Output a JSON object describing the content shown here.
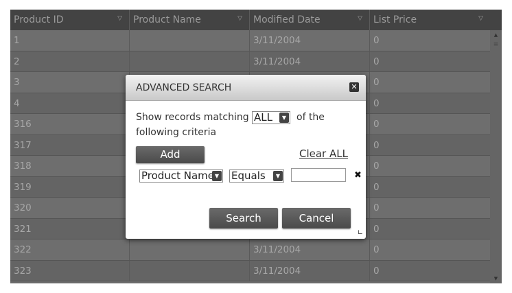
{
  "grid": {
    "columns": [
      {
        "label": "Product ID"
      },
      {
        "label": "Product Name"
      },
      {
        "label": "Modified Date"
      },
      {
        "label": "List Price"
      }
    ],
    "rows": [
      {
        "id": "1",
        "name": "",
        "date": "3/11/2004",
        "price": "0"
      },
      {
        "id": "2",
        "name": "",
        "date": "3/11/2004",
        "price": "0"
      },
      {
        "id": "3",
        "name": "",
        "date": "",
        "price": "0"
      },
      {
        "id": "4",
        "name": "",
        "date": "",
        "price": "0"
      },
      {
        "id": "316",
        "name": "",
        "date": "",
        "price": "0"
      },
      {
        "id": "317",
        "name": "",
        "date": "",
        "price": "0"
      },
      {
        "id": "318",
        "name": "",
        "date": "",
        "price": "0"
      },
      {
        "id": "319",
        "name": "",
        "date": "",
        "price": "0"
      },
      {
        "id": "320",
        "name": "",
        "date": "",
        "price": "0"
      },
      {
        "id": "321",
        "name": "",
        "date": "",
        "price": "0"
      },
      {
        "id": "322",
        "name": "",
        "date": "3/11/2004",
        "price": "0"
      },
      {
        "id": "323",
        "name": "",
        "date": "3/11/2004",
        "price": "0"
      }
    ],
    "filter_icon": "filter-icon",
    "scroll_up_icon": "scroll-up-icon",
    "scroll_down_icon": "scroll-down-icon"
  },
  "dialog": {
    "title": "ADVANCED SEARCH",
    "close_icon": "close-icon",
    "match_prefix": "Show records matching",
    "match_value": "ALL",
    "match_suffix": "of the",
    "match_line2": "following criteria",
    "add_label": "Add",
    "clear_label": "Clear ALL",
    "criteria": {
      "field": "Product Name",
      "operator": "Equals",
      "value": "",
      "remove_icon": "remove-criterion-icon"
    },
    "search_label": "Search",
    "cancel_label": "Cancel",
    "resize_icon": "resize-grip-icon"
  }
}
